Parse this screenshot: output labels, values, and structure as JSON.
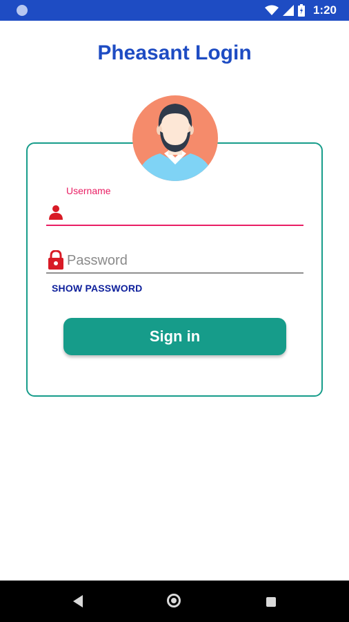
{
  "status_bar": {
    "time": "1:20",
    "icons": [
      "circle-icon",
      "wifi-icon",
      "signal-icon",
      "battery-icon"
    ]
  },
  "app": {
    "title": "Pheasant Login",
    "accent_color": "#1e4cc3",
    "teal": "#169c8a",
    "pink": "#e91e63"
  },
  "form": {
    "username": {
      "label": "Username",
      "value": "",
      "icon": "person-icon"
    },
    "password": {
      "placeholder": "Password",
      "value": "",
      "icon": "lock-icon"
    },
    "show_password_label": "SHOW PASSWORD",
    "signin_label": "Sign in"
  },
  "nav_bar": {
    "icons": [
      "back-icon",
      "home-icon",
      "recents-icon"
    ]
  }
}
